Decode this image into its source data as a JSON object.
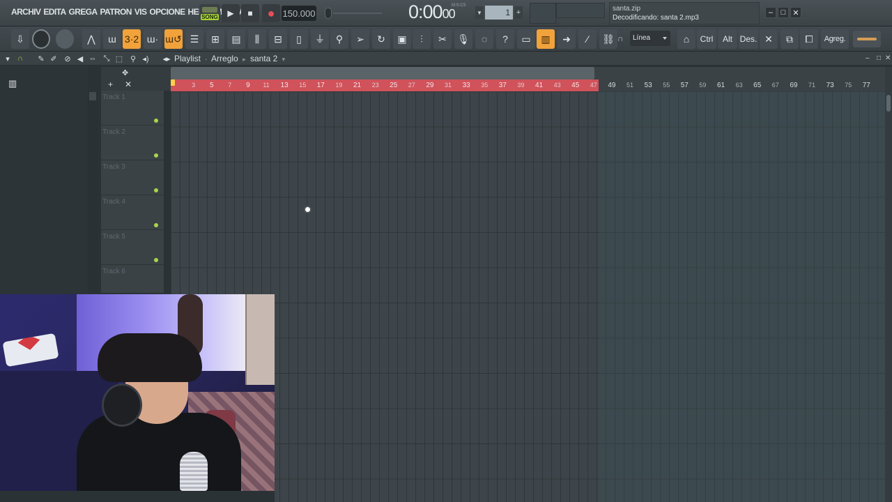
{
  "menu": {
    "items": [
      "ARCHIV",
      "EDITA",
      "GREGA",
      "PATRON",
      "VIS",
      "OPCIONE",
      "HERRAMIENTA"
    ]
  },
  "transport": {
    "song_label": "SONG",
    "tempo": "150.000",
    "time_main": "0:00",
    "time_small": "00",
    "time_units": "M:S:CS",
    "pattern_number": "1"
  },
  "hint": {
    "line1": "santa.zip",
    "line2": "Decodificando: santa 2.mp3"
  },
  "toolbar": {
    "snap_value": "Línea",
    "ctrl_label": "Ctrl",
    "alt_label": "Alt",
    "des_label": "Des.",
    "agreg_label": "Agreg."
  },
  "playlist": {
    "title_part1": "Playlist",
    "title_part2": "Arreglo",
    "title_part3": "santa 2"
  },
  "tracks": [
    {
      "name": "Track 1"
    },
    {
      "name": "Track 2"
    },
    {
      "name": "Track 3"
    },
    {
      "name": "Track 4"
    },
    {
      "name": "Track 5"
    },
    {
      "name": "Track 6"
    }
  ],
  "ruler_ticks": [
    {
      "label": "3",
      "big": false
    },
    {
      "label": "5",
      "big": true
    },
    {
      "label": "7",
      "big": false
    },
    {
      "label": "9",
      "big": true
    },
    {
      "label": "11",
      "big": false
    },
    {
      "label": "13",
      "big": true
    },
    {
      "label": "15",
      "big": false
    },
    {
      "label": "17",
      "big": true
    },
    {
      "label": "19",
      "big": false
    },
    {
      "label": "21",
      "big": true
    },
    {
      "label": "23",
      "big": false
    },
    {
      "label": "25",
      "big": true
    },
    {
      "label": "27",
      "big": false
    },
    {
      "label": "29",
      "big": true
    },
    {
      "label": "31",
      "big": false
    },
    {
      "label": "33",
      "big": true
    },
    {
      "label": "35",
      "big": false
    },
    {
      "label": "37",
      "big": true
    },
    {
      "label": "39",
      "big": false
    },
    {
      "label": "41",
      "big": true
    },
    {
      "label": "43",
      "big": false
    },
    {
      "label": "45",
      "big": true
    },
    {
      "label": "47",
      "big": false
    },
    {
      "label": "49",
      "big": true
    },
    {
      "label": "51",
      "big": false
    },
    {
      "label": "53",
      "big": true
    },
    {
      "label": "55",
      "big": false
    },
    {
      "label": "57",
      "big": true
    },
    {
      "label": "59",
      "big": false
    },
    {
      "label": "61",
      "big": true
    },
    {
      "label": "63",
      "big": false
    },
    {
      "label": "65",
      "big": true
    },
    {
      "label": "67",
      "big": false
    },
    {
      "label": "69",
      "big": true
    },
    {
      "label": "71",
      "big": false
    },
    {
      "label": "73",
      "big": true
    },
    {
      "label": "75",
      "big": false
    },
    {
      "label": "77",
      "big": true
    }
  ],
  "colors": {
    "loop_region": "#d0525b",
    "accent_orange": "#f1a23a",
    "track_dot": "#a8d54a"
  },
  "icons": {
    "play": "play-icon",
    "stop": "stop-icon",
    "record": "record-icon"
  }
}
